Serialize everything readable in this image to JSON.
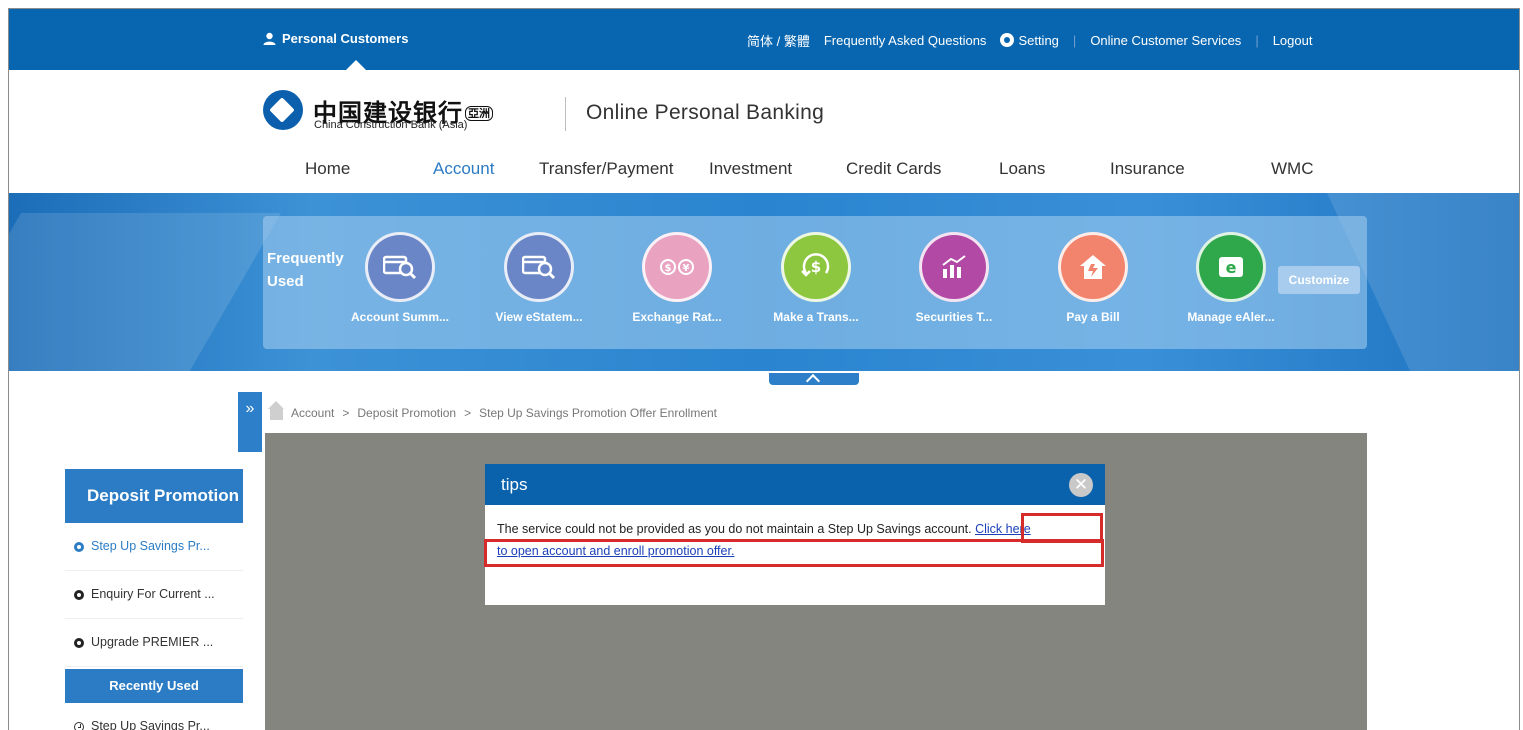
{
  "topbar": {
    "personal": "Personal Customers",
    "lang": "简体 / 繁體",
    "faq": "Frequently Asked Questions",
    "setting": "Setting",
    "online_cs": "Online Customer Services",
    "logout": "Logout",
    "color": "#0866b0"
  },
  "header": {
    "bank_cn": "中国建设银行",
    "bank_cn_suffix": "亞洲",
    "bank_en": "China Construction Bank (Asia)",
    "product": "Online Personal Banking"
  },
  "nav": {
    "items": [
      "Home",
      "Account",
      "Transfer/Payment",
      "Investment",
      "Credit Cards",
      "Loans",
      "Insurance",
      "WMC"
    ],
    "active": "Account"
  },
  "frequently_used": {
    "label_1": "Frequently",
    "label_2": "Used",
    "items": [
      {
        "label": "Account Summ...",
        "icon": "card-search-icon",
        "color": "#6b86c6"
      },
      {
        "label": "View eStatem...",
        "icon": "card-search-icon",
        "color": "#6b86c6"
      },
      {
        "label": "Exchange Rat...",
        "icon": "currency-exchange-icon",
        "color": "#e9a3c0"
      },
      {
        "label": "Make a Trans...",
        "icon": "dollar-transfer-icon",
        "color": "#8dc63f"
      },
      {
        "label": "Securities T...",
        "icon": "stock-chart-icon",
        "color": "#b24aa5"
      },
      {
        "label": "Pay a Bill",
        "icon": "house-bill-icon",
        "color": "#f2846e"
      },
      {
        "label": "Manage eAler...",
        "icon": "e-alert-icon",
        "color": "#2ea84a"
      }
    ],
    "customize": "Customize"
  },
  "breadcrumb": [
    "Account",
    "Deposit Promotion",
    "Step Up Savings Promotion Offer Enrollment"
  ],
  "breadcrumb_sep": ">",
  "sidebar": {
    "title": "Deposit Promotion",
    "items": [
      "Step Up Savings Pr...",
      "Enquiry For Current ...",
      "Upgrade PREMIER ..."
    ],
    "recently_used": "Recently Used",
    "recent_items": [
      "Step Up Savings Pr..."
    ]
  },
  "modal": {
    "title": "tips",
    "message": "The service could not be provided as you do not maintain a Step Up Savings account.",
    "link_1": "Click here",
    "link_2": "to open account and enroll promotion offer.",
    "highlight_color": "#d52b2b"
  }
}
